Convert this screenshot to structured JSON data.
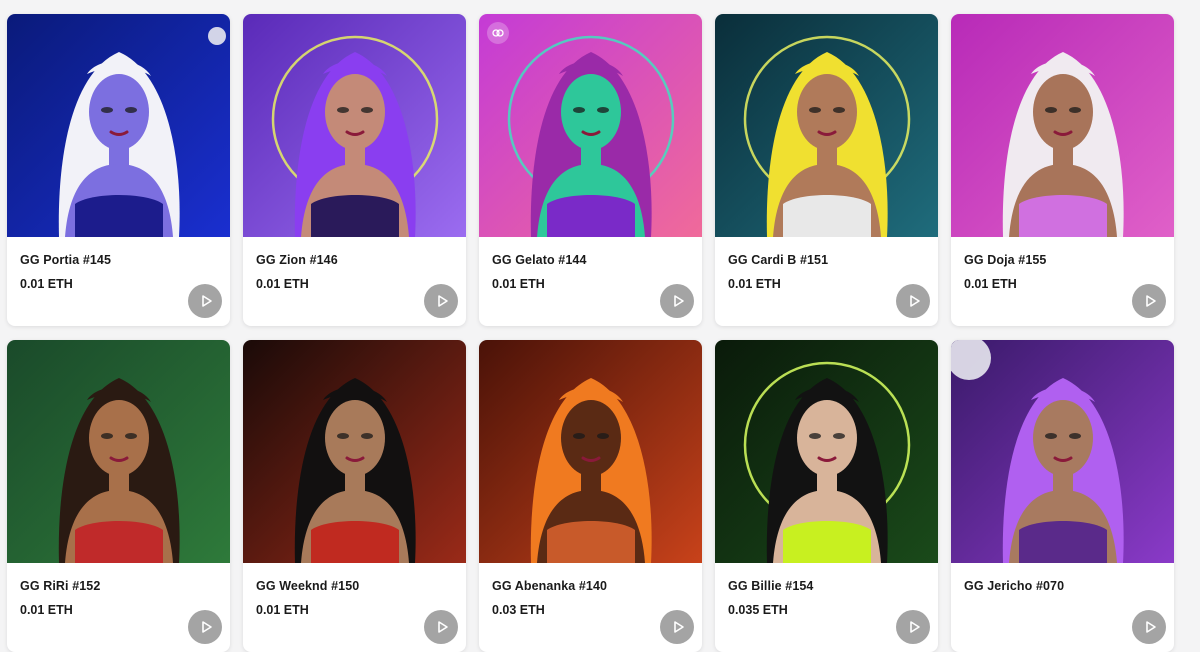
{
  "items": [
    {
      "name": "GG Portia #145",
      "price": "0.01 ETH",
      "bg1": "#0a1a7a",
      "bg2": "#1a2fd0",
      "hair": "#f2f2f8",
      "skin": "#7c6fe0",
      "top": "#1c1c8c"
    },
    {
      "name": "GG Zion #146",
      "price": "0.01 ETH",
      "bg1": "#5a2ab8",
      "bg2": "#9b6cf0",
      "hair": "#8a3ef0",
      "skin": "#c48a78",
      "top": "#2a1a5a"
    },
    {
      "name": "GG Gelato #144",
      "price": "0.01 ETH",
      "bg1": "#c43bd6",
      "bg2": "#f06a9a",
      "hair": "#9a2aa8",
      "skin": "#2ec79a",
      "top": "#7a2ac8"
    },
    {
      "name": "GG Cardi B #151",
      "price": "0.01 ETH",
      "bg1": "#0a2e3a",
      "bg2": "#1f6c7c",
      "hair": "#f0e030",
      "skin": "#b07a5a",
      "top": "#e8e8e8"
    },
    {
      "name": "GG Doja #155",
      "price": "0.01 ETH",
      "bg1": "#b82ab8",
      "bg2": "#e060c8",
      "hair": "#f0eaf0",
      "skin": "#a8745a",
      "top": "#d070e0"
    },
    {
      "name": "GG RiRi #152",
      "price": "0.01 ETH",
      "bg1": "#1a4a2a",
      "bg2": "#2e7a3a",
      "hair": "#2a1a12",
      "skin": "#a8704a",
      "top": "#c02a2a"
    },
    {
      "name": "GG Weeknd #150",
      "price": "0.01 ETH",
      "bg1": "#1a0a08",
      "bg2": "#9a2a18",
      "hair": "#121010",
      "skin": "#a87a5a",
      "top": "#c02a20"
    },
    {
      "name": "GG Abenanka #140",
      "price": "0.03 ETH",
      "bg1": "#4a1208",
      "bg2": "#c8421a",
      "hair": "#f07a20",
      "skin": "#5a2a14",
      "top": "#c85a2a"
    },
    {
      "name": "GG Billie #154",
      "price": "0.035 ETH",
      "bg1": "#0a1a0a",
      "bg2": "#1a4a1a",
      "hair": "#121212",
      "skin": "#d8b49a",
      "top": "#c8f020"
    },
    {
      "name": "GG Jericho #070",
      "price": "",
      "bg1": "#3a1a6a",
      "bg2": "#8a3ac8",
      "hair": "#b060f0",
      "skin": "#a87a60",
      "top": "#5a2a8a"
    }
  ]
}
